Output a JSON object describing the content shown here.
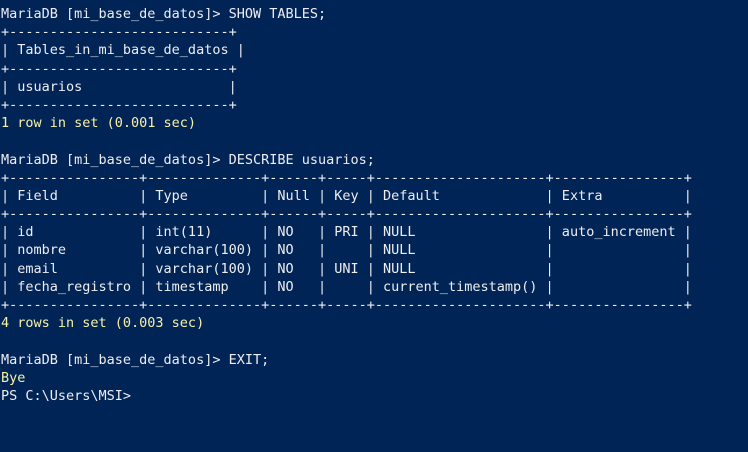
{
  "colors": {
    "background": "#012456",
    "foreground": "#eeedf0",
    "status": "#f9f1a5"
  },
  "session": {
    "show_tables": {
      "prompt_command": "MariaDB [mi_base_de_datos]> SHOW TABLES;",
      "table_lines": [
        "+---------------------------+",
        "| Tables_in_mi_base_de_datos |",
        "+---------------------------+",
        "| usuarios                  |",
        "+---------------------------+"
      ],
      "status": "1 row in set (0.001 sec)"
    },
    "describe": {
      "prompt_command": "MariaDB [mi_base_de_datos]> DESCRIBE usuarios;",
      "header_columns": [
        "Field",
        "Type",
        "Null",
        "Key",
        "Default",
        "Extra"
      ],
      "rows": [
        {
          "field": "id",
          "type": "int(11)",
          "null": "NO",
          "key": "PRI",
          "default": "NULL",
          "extra": "auto_increment"
        },
        {
          "field": "nombre",
          "type": "varchar(100)",
          "null": "NO",
          "key": "",
          "default": "NULL",
          "extra": ""
        },
        {
          "field": "email",
          "type": "varchar(100)",
          "null": "NO",
          "key": "UNI",
          "default": "NULL",
          "extra": ""
        },
        {
          "field": "fecha_registro",
          "type": "timestamp",
          "null": "NO",
          "key": "",
          "default": "current_timestamp()",
          "extra": ""
        }
      ],
      "border_line": "+----------------+--------------+------+-----+---------------------+----------------+",
      "header_line": "| Field          | Type         | Null | Key | Default             | Extra          |",
      "row_lines": [
        "| id             | int(11)      | NO   | PRI | NULL                | auto_increment |",
        "| nombre         | varchar(100) | NO   |     | NULL                |                |",
        "| email          | varchar(100) | NO   | UNI | NULL                |                |",
        "| fecha_registro | timestamp    | NO   |     | current_timestamp() |                |"
      ],
      "status": "4 rows in set (0.003 sec)"
    },
    "exit": {
      "prompt_command": "MariaDB [mi_base_de_datos]> EXIT;",
      "bye": "Bye"
    },
    "ps_prompt": "PS C:\\Users\\MSI>"
  }
}
